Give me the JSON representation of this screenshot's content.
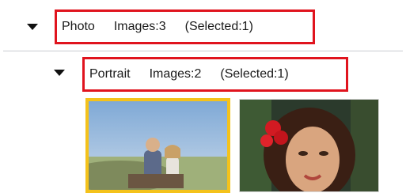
{
  "groups": [
    {
      "name": "Photo",
      "images": "Images:3",
      "selected": "(Selected:1)"
    },
    {
      "name": "Portrait",
      "images": "Images:2",
      "selected": "(Selected:1)"
    }
  ],
  "thumbnails": [
    {
      "selected": true,
      "accent": "#f4c21b"
    },
    {
      "selected": false,
      "accent": "#d7d7d7"
    }
  ],
  "colors": {
    "highlight_border": "#e0141e",
    "divider": "#c9ccd1"
  }
}
